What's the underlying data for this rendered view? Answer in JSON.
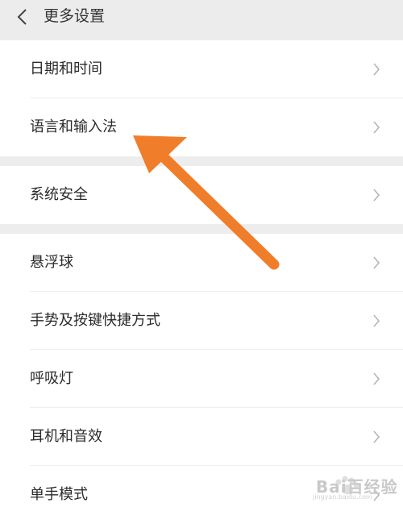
{
  "header": {
    "title": "更多设置",
    "back_icon": "chevron-left-icon"
  },
  "groups": [
    {
      "items": [
        {
          "label": "日期和时间"
        },
        {
          "label": "语言和输入法"
        }
      ]
    },
    {
      "items": [
        {
          "label": "系统安全"
        }
      ]
    },
    {
      "items": [
        {
          "label": "悬浮球"
        },
        {
          "label": "手势及按键快捷方式"
        },
        {
          "label": "呼吸灯"
        },
        {
          "label": "耳机和音效"
        },
        {
          "label": "单手模式"
        }
      ]
    }
  ],
  "annotation": {
    "arrow_color": "#f07d2a",
    "arrow_icon": "pointer-arrow"
  },
  "watermark": {
    "text": "Bai百经验",
    "sub": "jingyan.baidu.com"
  }
}
